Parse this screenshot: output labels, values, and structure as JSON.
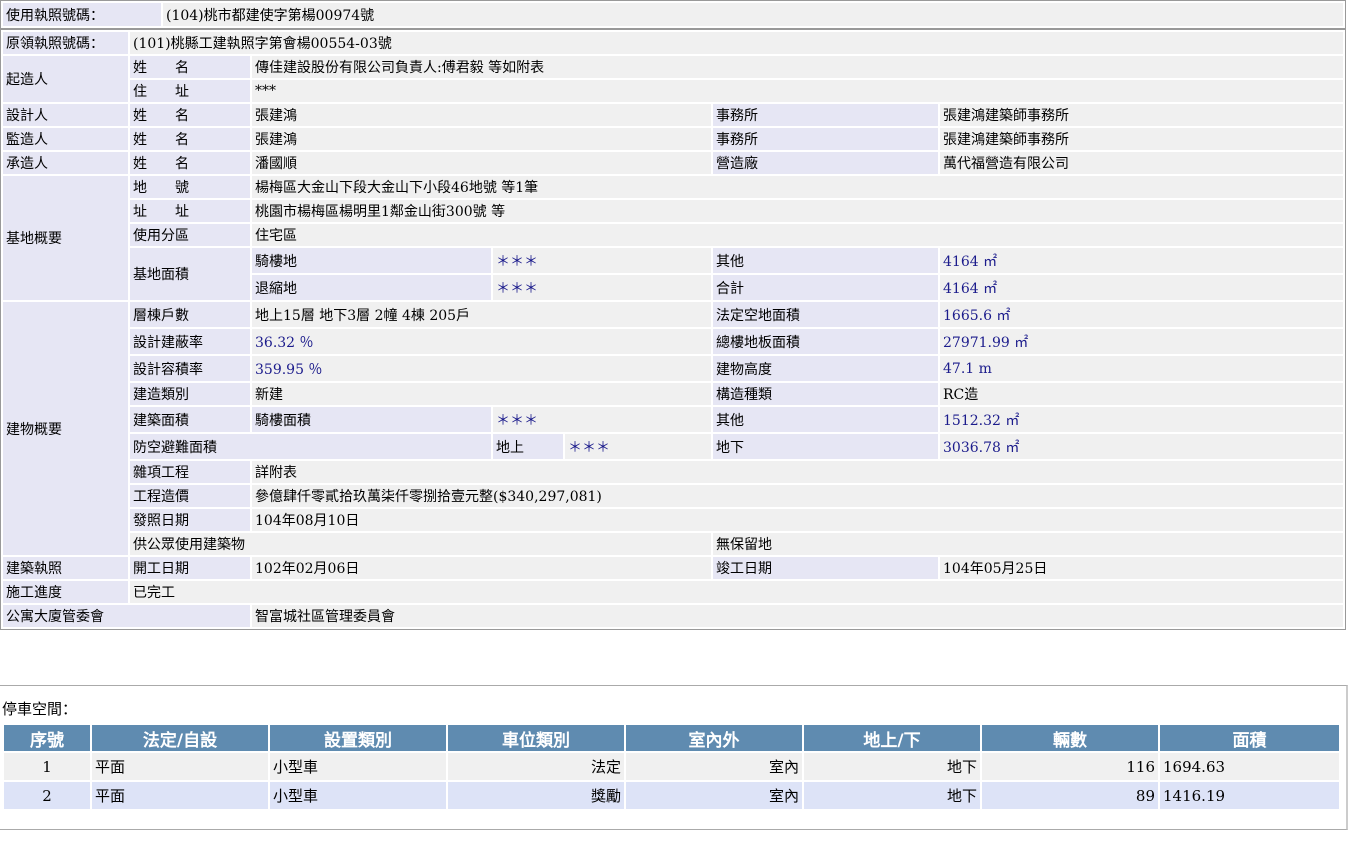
{
  "top": {
    "label": "使用執照號碼：",
    "value": "(104)桃市都建使字第楊00974號"
  },
  "orig": {
    "label": "原領執照號碼：",
    "value": "(101)桃縣工建執照字第會楊00554-03號"
  },
  "builder": {
    "group": "起造人",
    "name_label": "姓　　名",
    "name": "傳佳建設股份有限公司負責人:傅君毅 等如附表",
    "addr_label": "住　　址",
    "addr": "***"
  },
  "designer": {
    "group": "設計人",
    "name_label": "姓　　名",
    "name": "張建鴻",
    "office_label": "事務所",
    "office": "張建鴻建築師事務所"
  },
  "supervisor": {
    "group": "監造人",
    "name_label": "姓　　名",
    "name": "張建鴻",
    "office_label": "事務所",
    "office": "張建鴻建築師事務所"
  },
  "contractor": {
    "group": "承造人",
    "name_label": "姓　　名",
    "name": "潘國順",
    "factory_label": "營造廠",
    "factory": "萬代福營造有限公司"
  },
  "site": {
    "group": "基地概要",
    "lot_label": "地　　號",
    "lot": "楊梅區大金山下段大金山下小段46地號 等1筆",
    "addr_label": "址　　址",
    "addr": "桃園市楊梅區楊明里1鄰金山街300號 等",
    "zone_label": "使用分區",
    "zone": "住宅區",
    "area_label": "基地面積",
    "arcade_label": "騎樓地",
    "arcade": "＊＊＊",
    "other_label": "其他",
    "other": "4164 ㎡",
    "setback_label": "退縮地",
    "setback": "＊＊＊",
    "total_label": "合計",
    "total": "4164 ㎡"
  },
  "bldg": {
    "group": "建物概要",
    "floors_label": "層棟戶數",
    "floors": "地上15層 地下3層 2幢 4棟 205戶",
    "open_label": "法定空地面積",
    "open": "1665.6 ㎡",
    "cov_label": "設計建蔽率",
    "cov": "36.32 ％",
    "floor_area_label": "總樓地板面積",
    "floor_area": "27971.99 ㎡",
    "far_label": "設計容積率",
    "far": "359.95 ％",
    "height_label": "建物高度",
    "height": "47.1 m",
    "type_label": "建造類別",
    "type": "新建",
    "struct_label": "構造種類",
    "struct": "RC造",
    "barea_label": "建築面積",
    "arcade_area_label": "騎樓面積",
    "arcade_area": "＊＊＊",
    "barea_other_label": "其他",
    "barea_other": "1512.32 ㎡",
    "shelter_label": "防空避難面積",
    "above_label": "地上",
    "above": "＊＊＊",
    "below_label": "地下",
    "below": "3036.78 ㎡",
    "misc_label": "雜項工程",
    "misc": "詳附表",
    "cost_label": "工程造價",
    "cost": "參億肆仟零貳拾玖萬柒仟零捌拾壹元整($340,297,081)",
    "issue_label": "發照日期",
    "issue": "104年08月10日",
    "public_label": "供公眾使用建築物",
    "reserve_label": "無保留地"
  },
  "permit": {
    "group": "建築執照",
    "start_label": "開工日期",
    "start": "102年02月06日",
    "done_label": "竣工日期",
    "done": "104年05月25日"
  },
  "progress": {
    "label": "施工進度",
    "value": "已完工"
  },
  "committee": {
    "label": "公寓大廈管委會",
    "value": "智富城社區管理委員會"
  },
  "parking": {
    "title": "停車空間：",
    "headers": [
      "序號",
      "法定/自設",
      "設置類別",
      "車位類別",
      "室內外",
      "地上/下",
      "輛數",
      "面積"
    ],
    "rows": [
      [
        "1",
        "平面",
        "小型車",
        "法定",
        "室內",
        "地下",
        "116",
        "1694.63"
      ],
      [
        "2",
        "平面",
        "小型車",
        "獎勵",
        "室內",
        "地下",
        "89",
        "1416.19"
      ]
    ]
  }
}
